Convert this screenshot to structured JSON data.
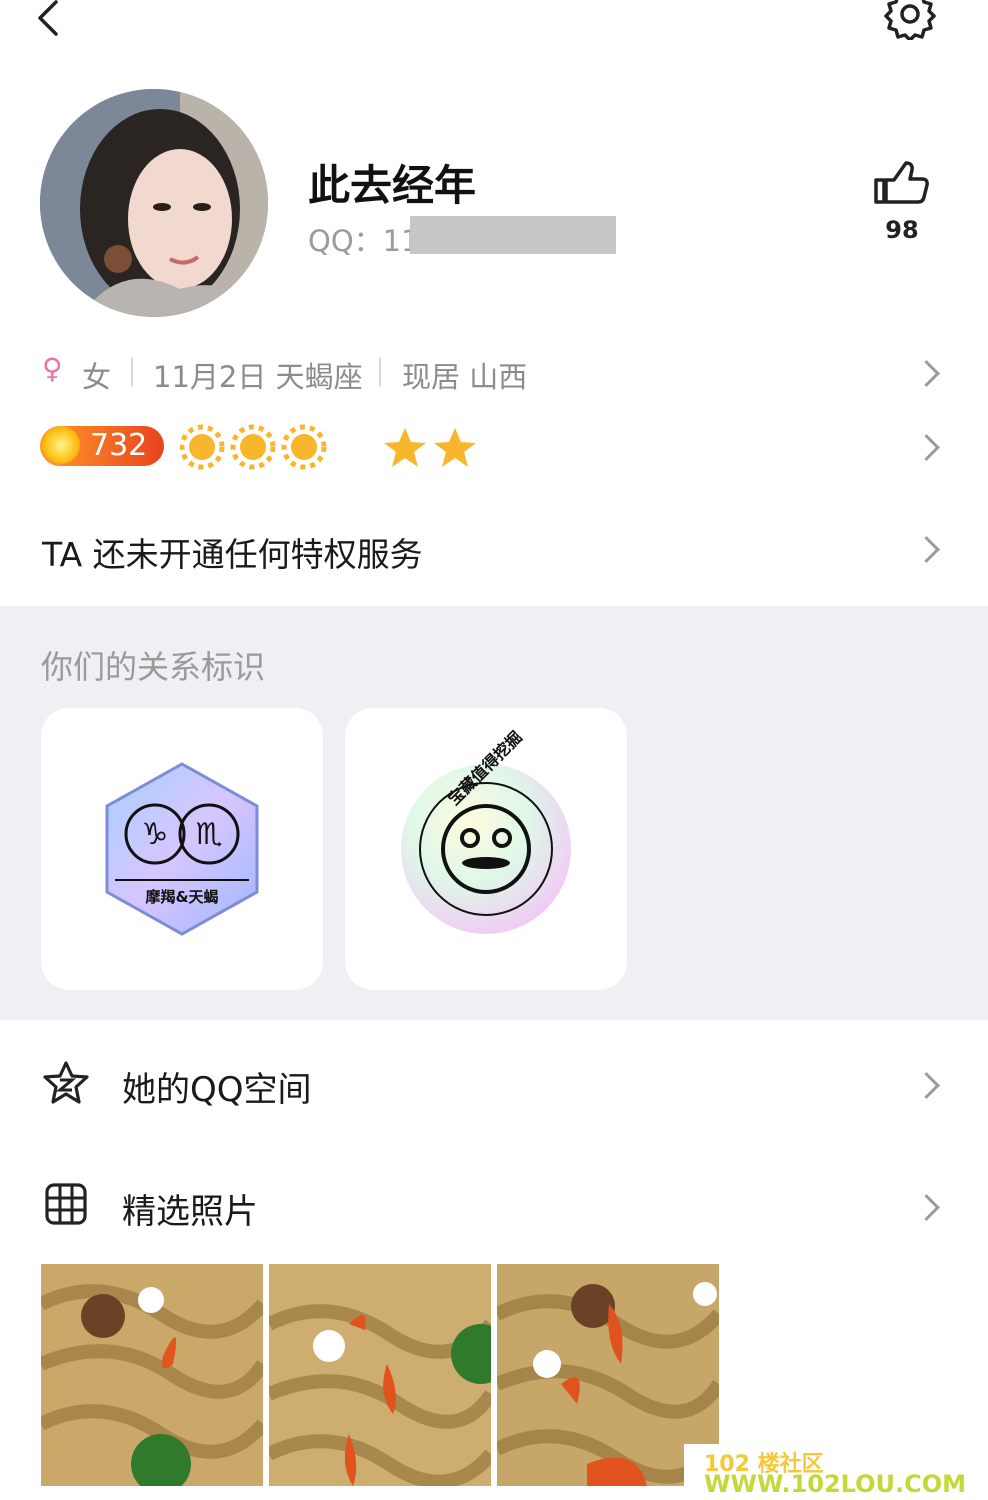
{
  "header": {
    "back_icon": "chevron-left-icon",
    "settings_icon": "gear-icon"
  },
  "profile": {
    "name": "此去经年",
    "qq_label": "QQ：11",
    "likes": "98",
    "like_icon": "thumbs-up-icon"
  },
  "info": {
    "gender_symbol": "♀",
    "gender": "女",
    "birthday": "11月2日 天蝎座",
    "location": "现居 山西"
  },
  "level": {
    "value": "732"
  },
  "privilege": {
    "text": "TA 还未开通任何特权服务"
  },
  "relations": {
    "title": "你们的关系标识",
    "badge1_text": "摩羯&天蝎",
    "badge2_text": "宝藏值得挖掘"
  },
  "qzone": {
    "label": "她的QQ空间",
    "icon": "star-z-icon"
  },
  "photos": {
    "label": "精选照片",
    "icon": "grid-icon"
  },
  "watermark": {
    "line1": "102 楼社区",
    "line2": "WWW.102LOU.COM"
  },
  "colors": {
    "accent_orange": "#f06b1a",
    "gold": "#f7b82b",
    "panel_gray": "#efeff4"
  }
}
